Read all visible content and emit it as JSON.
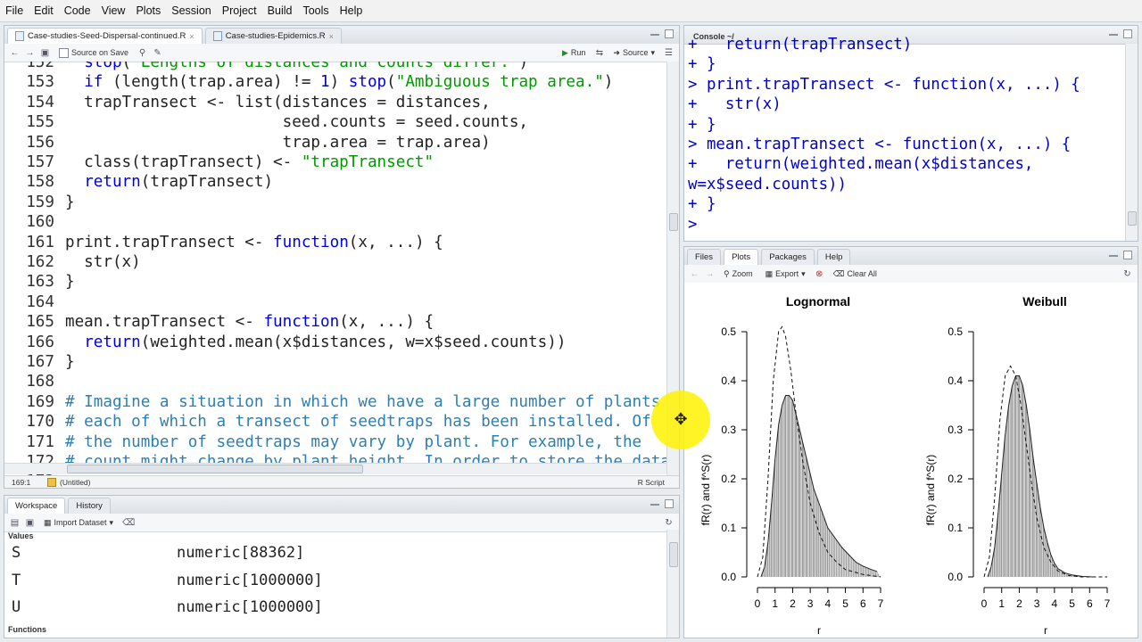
{
  "menu": [
    "File",
    "Edit",
    "Code",
    "View",
    "Plots",
    "Session",
    "Project",
    "Build",
    "Tools",
    "Help"
  ],
  "editor": {
    "tabs": [
      {
        "label": "Case-studies-Seed-Dispersal-continued.R",
        "active": true
      },
      {
        "label": "Case-studies-Epidemics.R",
        "active": false
      }
    ],
    "toolbar": {
      "source_on_save": "Source on Save",
      "run": "Run",
      "source": "Source"
    },
    "lines": [
      {
        "num": "152",
        "html": "  <span class=\"kw\">stop</span>(<span class=\"str\">\"Lengths of distances and counts differ.\"</span>)"
      },
      {
        "num": "153",
        "html": "  <span class=\"kw\">if</span> (length(trap.area) != <span class=\"num\">1</span>) <span class=\"kw\">stop</span>(<span class=\"str\">\"Ambiguous trap area.\"</span>)"
      },
      {
        "num": "154",
        "html": "  trapTransect &lt;- list(distances = distances,"
      },
      {
        "num": "155",
        "html": "                       seed.counts = seed.counts,"
      },
      {
        "num": "156",
        "html": "                       trap.area = trap.area)"
      },
      {
        "num": "157",
        "html": "  class(trapTransect) &lt;- <span class=\"str\">\"trapTransect\"</span>"
      },
      {
        "num": "158",
        "html": "  <span class=\"kw\">return</span>(trapTransect)"
      },
      {
        "num": "159",
        "html": "}"
      },
      {
        "num": "160",
        "html": ""
      },
      {
        "num": "161",
        "html": "print.trapTransect &lt;- <span class=\"kw\">function</span>(x, ...) {"
      },
      {
        "num": "162",
        "html": "  str(x)"
      },
      {
        "num": "163",
        "html": "}"
      },
      {
        "num": "164",
        "html": ""
      },
      {
        "num": "165",
        "html": "mean.trapTransect &lt;- <span class=\"kw\">function</span>(x, ...) {"
      },
      {
        "num": "166",
        "html": "  <span class=\"kw\">return</span>(weighted.mean(x$distances, w=x$seed.counts))"
      },
      {
        "num": "167",
        "html": "}"
      },
      {
        "num": "168",
        "html": ""
      },
      {
        "num": "169",
        "html": "<span class=\"cmt\"># Imagine a situation in which we have a large number of plants</span>"
      },
      {
        "num": "170",
        "html": "<span class=\"cmt\"># each of which a transect of seedtraps has been installed. Of</span>"
      },
      {
        "num": "171",
        "html": "<span class=\"cmt\"># the number of seedtraps may vary by plant. For example, the</span>"
      },
      {
        "num": "172",
        "html": "<span class=\"cmt\"># count might change by plant height. In order to store the data</span>"
      },
      {
        "num": "173",
        "html": ""
      }
    ],
    "status": {
      "position": "169:1",
      "scope": "(Untitled)",
      "filetype": "R Script"
    }
  },
  "console": {
    "title": "Console ~/",
    "lines": [
      "+   return(trapTransect)",
      "+ }",
      "> print.trapTransect <- function(x, ...) {",
      "+   str(x)",
      "+ }",
      "> mean.trapTransect <- function(x, ...) {",
      "+   return(weighted.mean(x$distances,",
      "w=x$seed.counts))",
      "+ }",
      "> "
    ]
  },
  "workspace": {
    "tabs": [
      "Workspace",
      "History"
    ],
    "import_label": "Import Dataset",
    "values_header": "Values",
    "functions_header": "Functions",
    "rows": [
      {
        "name": "S",
        "value": "numeric[88362]"
      },
      {
        "name": "T",
        "value": "numeric[1000000]"
      },
      {
        "name": "U",
        "value": "numeric[1000000]"
      }
    ]
  },
  "plots_pane": {
    "tabs": [
      "Files",
      "Plots",
      "Packages",
      "Help"
    ],
    "toolbar": {
      "zoom": "Zoom",
      "export": "Export",
      "clear": "Clear All"
    }
  },
  "chart_data": [
    {
      "type": "area",
      "title": "Lognormal",
      "xlabel": "r",
      "ylabel": "fR(r) and f^S(r)",
      "xticks": [
        "0",
        "1",
        "2",
        "3",
        "4",
        "5",
        "6",
        "7"
      ],
      "yticks": [
        "0.0",
        "0.1",
        "0.2",
        "0.3",
        "0.4",
        "0.5"
      ],
      "xlim": [
        0,
        7
      ],
      "ylim": [
        0,
        0.5
      ],
      "series": [
        {
          "kind": "histogram",
          "x": [
            0.2,
            0.4,
            0.6,
            0.8,
            1.0,
            1.2,
            1.4,
            1.6,
            1.8,
            2.0,
            2.2,
            2.4,
            2.6,
            2.8,
            3.0,
            3.2,
            3.4,
            3.6,
            3.8,
            4.0,
            4.4,
            4.8,
            5.2,
            5.6,
            6.0,
            6.4,
            6.8
          ],
          "values": [
            0.0,
            0.02,
            0.07,
            0.15,
            0.24,
            0.31,
            0.35,
            0.37,
            0.37,
            0.36,
            0.33,
            0.3,
            0.27,
            0.24,
            0.21,
            0.18,
            0.16,
            0.14,
            0.12,
            0.1,
            0.08,
            0.06,
            0.045,
            0.03,
            0.022,
            0.016,
            0.011
          ]
        },
        {
          "kind": "dashed-line",
          "x": [
            0.0,
            0.3,
            0.6,
            0.9,
            1.2,
            1.4,
            1.6,
            1.9,
            2.2,
            2.6,
            3.0,
            3.5,
            4.0,
            4.5,
            5.0,
            6.0,
            7.0
          ],
          "values": [
            0.0,
            0.04,
            0.2,
            0.4,
            0.5,
            0.51,
            0.49,
            0.42,
            0.33,
            0.23,
            0.15,
            0.09,
            0.05,
            0.03,
            0.015,
            0.005,
            0.0
          ]
        }
      ]
    },
    {
      "type": "area",
      "title": "Weibull",
      "xlabel": "r",
      "ylabel": "fR(r) and f^S(r)",
      "xticks": [
        "0",
        "1",
        "2",
        "3",
        "4",
        "5",
        "6",
        "7"
      ],
      "yticks": [
        "0.0",
        "0.1",
        "0.2",
        "0.3",
        "0.4",
        "0.5"
      ],
      "xlim": [
        0,
        7
      ],
      "ylim": [
        0,
        0.5
      ],
      "series": [
        {
          "kind": "histogram",
          "x": [
            0.2,
            0.4,
            0.6,
            0.8,
            1.0,
            1.2,
            1.4,
            1.6,
            1.8,
            2.0,
            2.2,
            2.4,
            2.6,
            2.8,
            3.0,
            3.2,
            3.4,
            3.6,
            3.8,
            4.0,
            4.2,
            4.6,
            5.0,
            5.6,
            6.2
          ],
          "values": [
            0.0,
            0.02,
            0.06,
            0.13,
            0.21,
            0.29,
            0.35,
            0.39,
            0.41,
            0.41,
            0.39,
            0.35,
            0.3,
            0.24,
            0.19,
            0.14,
            0.1,
            0.07,
            0.045,
            0.028,
            0.017,
            0.008,
            0.004,
            0.001,
            0.0
          ]
        },
        {
          "kind": "dashed-line",
          "x": [
            0.0,
            0.3,
            0.6,
            0.9,
            1.2,
            1.5,
            1.8,
            2.1,
            2.4,
            2.7,
            3.0,
            3.4,
            3.8,
            4.2,
            4.8,
            5.5,
            7.0
          ],
          "values": [
            0.0,
            0.04,
            0.16,
            0.32,
            0.41,
            0.43,
            0.41,
            0.35,
            0.27,
            0.19,
            0.12,
            0.06,
            0.03,
            0.012,
            0.003,
            0.0,
            0.0
          ]
        }
      ]
    }
  ]
}
